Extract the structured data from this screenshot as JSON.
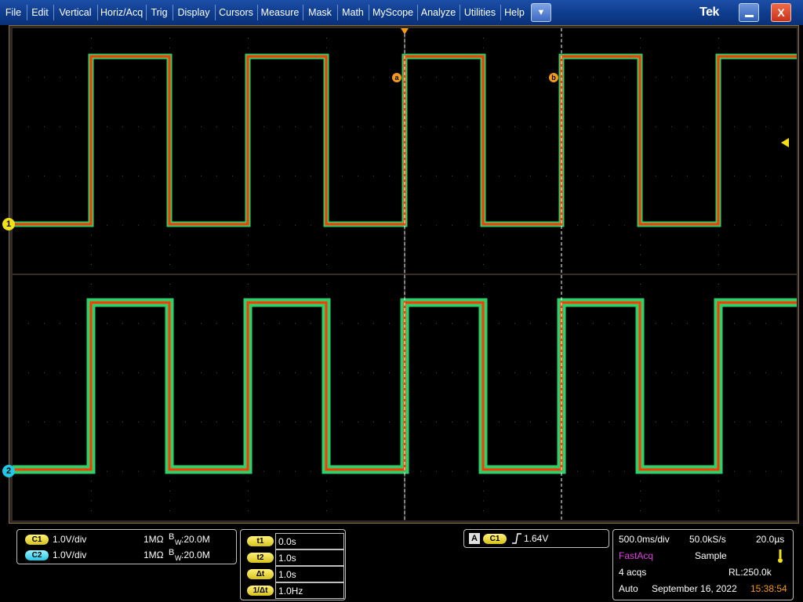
{
  "menu": {
    "items": [
      "File",
      "Edit",
      "Vertical",
      "Horiz/Acq",
      "Trig",
      "Display",
      "Cursors",
      "Measure",
      "Mask",
      "Math",
      "MyScope",
      "Analyze",
      "Utilities",
      "Help"
    ],
    "dropdown_glyph": "▼",
    "brand": "Tek",
    "close_glyph": "X"
  },
  "markers": {
    "ch1": "1",
    "ch2": "2",
    "cursor_a": "a",
    "cursor_b": "b"
  },
  "channels": [
    {
      "tag": "C1",
      "scale": "1.0V/div",
      "impedance": "1MΩ",
      "bw_prefix": "B",
      "bw_sub": "W",
      "bw": ":20.0M",
      "color": "#f2e01a"
    },
    {
      "tag": "C2",
      "scale": "1.0V/div",
      "impedance": "1MΩ",
      "bw_prefix": "B",
      "bw_sub": "W",
      "bw": ":20.0M",
      "color": "#22c7e6"
    }
  ],
  "cursors": [
    {
      "label": "t1",
      "value": "0.0s"
    },
    {
      "label": "t2",
      "value": "1.0s"
    },
    {
      "label": "Δt",
      "value": "1.0s"
    },
    {
      "label": "1/Δt",
      "value": "1.0Hz"
    }
  ],
  "trigger": {
    "mode": "A",
    "source": "C1",
    "slope_icon": "rising-edge-icon",
    "level": "1.64V"
  },
  "acq": {
    "timebase": "500.0ms/div",
    "sample_rate": "50.0kS/s",
    "resolution": "20.0µs",
    "mode_name": "FastAcq",
    "sample_mode": "Sample",
    "acqs": "4 acqs",
    "record_length": "RL:250.0k",
    "trigger_mode": "Auto",
    "date": "September 16, 2022",
    "time": "15:38:54"
  },
  "colors": {
    "ch1": "#f2e01a",
    "ch2": "#22c7e6",
    "trace": "#ff3a00",
    "cursor": "#f39a1e",
    "fastacq": "#e040e0",
    "time": "#f39a1e"
  }
}
